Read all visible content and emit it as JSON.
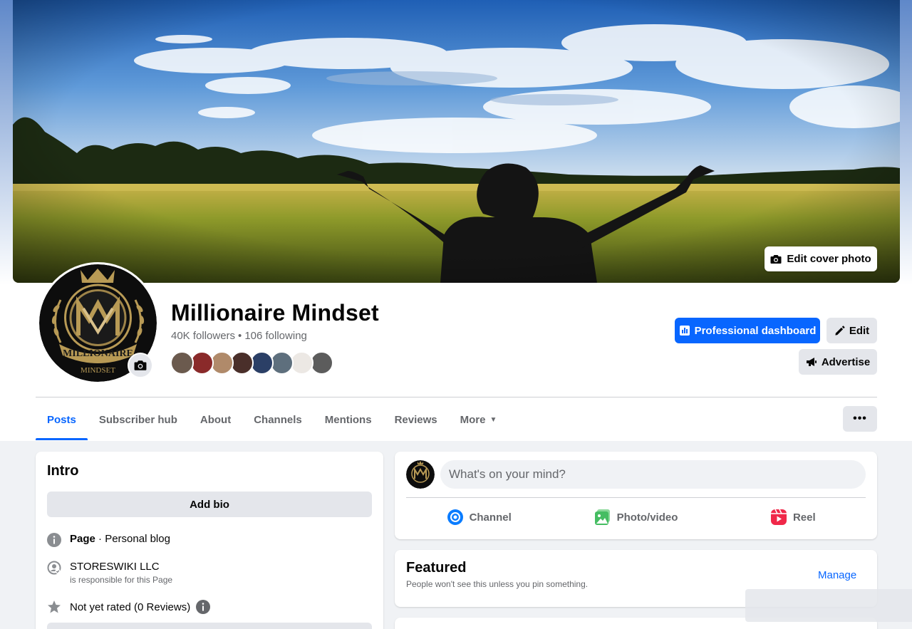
{
  "colors": {
    "accent": "#0866ff",
    "background": "#f0f2f5",
    "button_gray": "#e4e6eb",
    "secondary_text": "#65676b"
  },
  "cover": {
    "edit_label": "Edit cover photo"
  },
  "profile": {
    "name": "Millionaire Mindset",
    "followers": "40K followers",
    "separator": "•",
    "following": "106 following",
    "avatar_brand": "MILLIONAIRE",
    "avatar_tagline": "MINDSET",
    "friend_avatar_colors": [
      "#6b5a4e",
      "#8a2a2a",
      "#b08a6a",
      "#4a2f2a",
      "#2b3f66",
      "#5e6f7d",
      "#ece8e4",
      "#5c5c5c"
    ]
  },
  "actions": {
    "professional_dashboard": "Professional dashboard",
    "edit": "Edit",
    "advertise": "Advertise"
  },
  "tabs": [
    {
      "label": "Posts"
    },
    {
      "label": "Subscriber hub"
    },
    {
      "label": "About"
    },
    {
      "label": "Channels"
    },
    {
      "label": "Mentions"
    },
    {
      "label": "Reviews"
    },
    {
      "label": "More"
    }
  ],
  "more_button": "•••",
  "intro": {
    "title": "Intro",
    "add_bio": "Add bio",
    "page_label": "Page",
    "page_separator": " · ",
    "category": "Personal blog",
    "owner": "STORESWIKI LLC",
    "owner_note": "is responsible for this Page",
    "rating": "Not yet rated (0 Reviews)"
  },
  "composer": {
    "placeholder": "What's on your mind?",
    "channel": "Channel",
    "photo_video": "Photo/video",
    "reel": "Reel"
  },
  "featured": {
    "title": "Featured",
    "subtitle": "People won't see this unless you pin something.",
    "manage": "Manage"
  }
}
